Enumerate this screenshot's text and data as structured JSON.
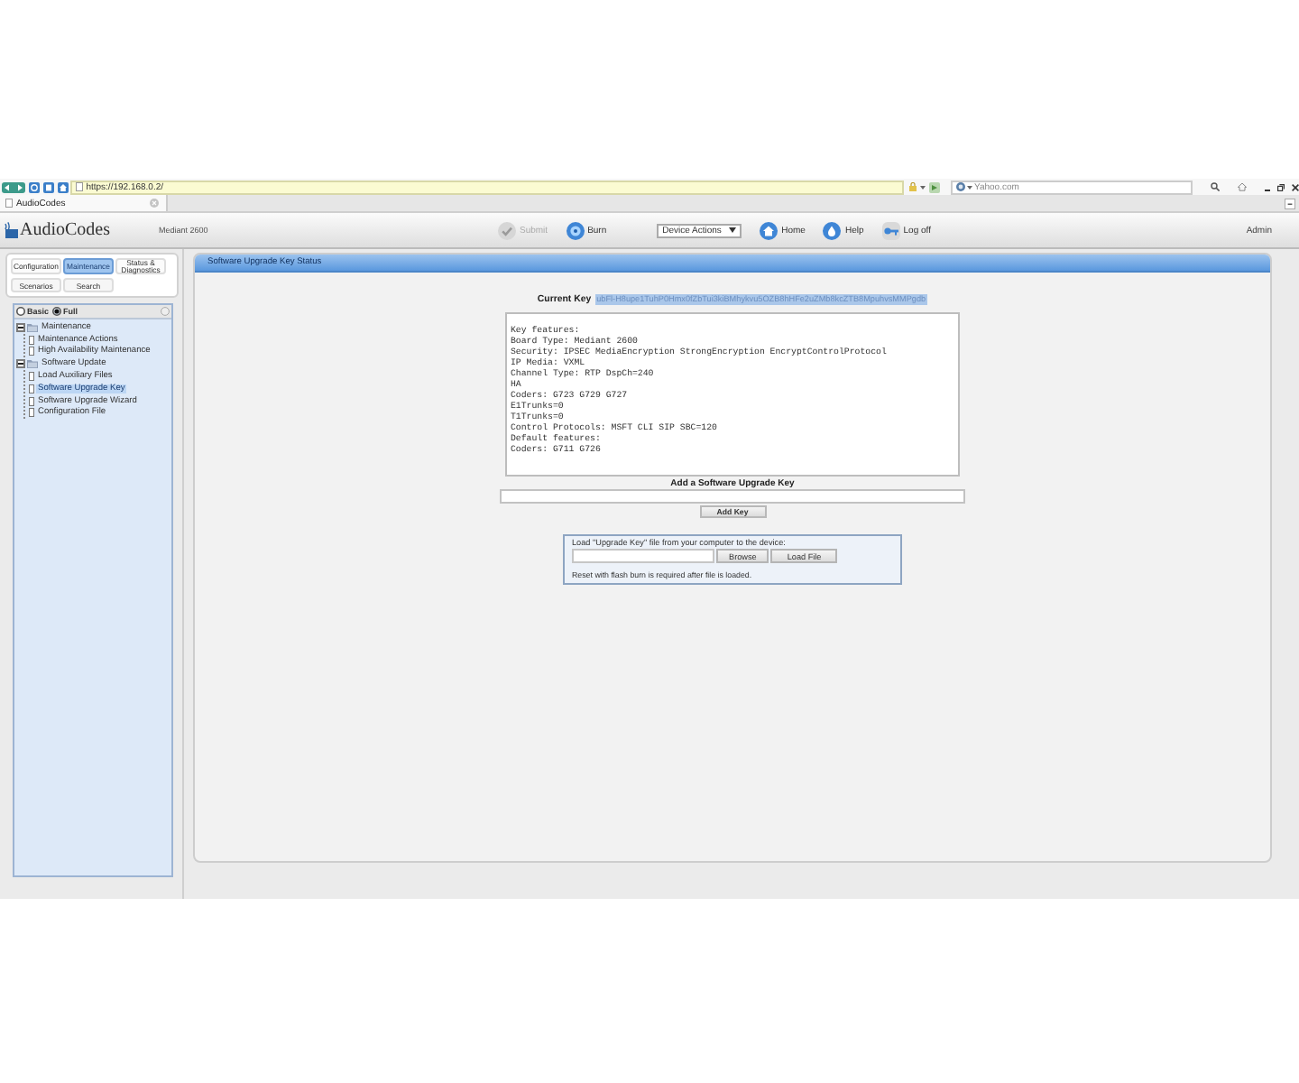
{
  "browser": {
    "address": "https://192.168.0.2/",
    "search": {
      "placeholder": "Yahoo.com"
    },
    "tab": "AudioCodes"
  },
  "header": {
    "logo": "AudioCodes",
    "device": "Mediant 2600",
    "toolbar": [
      {
        "label": "Submit",
        "kind": "button",
        "disabled": true
      },
      {
        "label": "Burn",
        "kind": "button",
        "disabled": false
      },
      {
        "label": "Device Actions",
        "kind": "dropdown",
        "disabled": false
      },
      {
        "label": "Home",
        "kind": "button",
        "disabled": false
      },
      {
        "label": "Help",
        "kind": "button",
        "disabled": false
      },
      {
        "label": "Log off",
        "kind": "button",
        "disabled": false
      }
    ],
    "user": "Admin"
  },
  "nav_tabs": [
    {
      "label": "Configuration",
      "selected": false
    },
    {
      "label": "Maintenance",
      "selected": true
    },
    {
      "label": "Status & Diagnostics",
      "selected": false
    }
  ],
  "nav_buttons": [
    "Scenarios",
    "Search"
  ],
  "view_mode": [
    {
      "label": "Basic",
      "selected": false
    },
    {
      "label": "Full",
      "selected": true
    }
  ],
  "tree": [
    {
      "label": "Maintenance",
      "expanded": true,
      "selected": false,
      "children": [
        {
          "label": "Maintenance Actions",
          "selected": false
        },
        {
          "label": "High Availability Maintenance",
          "selected": false
        }
      ]
    },
    {
      "label": "Software Update",
      "expanded": true,
      "selected": false,
      "children": [
        {
          "label": "Load Auxiliary Files",
          "selected": false
        },
        {
          "label": "Software Upgrade Key",
          "selected": true
        },
        {
          "label": "Software Upgrade Wizard",
          "selected": false
        },
        {
          "label": "Configuration File",
          "selected": false
        }
      ]
    }
  ],
  "panel": {
    "title": "Software Upgrade Key Status",
    "current_key": {
      "label": "Current Key",
      "value": "ubFl-H8upe1TuhP0Hmx0fZbTui3kiBMhykvu5OZB8hHFe2uZMb8kcZTB8MpuhvsMMPgdb"
    },
    "key_features": [
      "Key features:",
      "Board Type: Mediant 2600",
      "Security: IPSEC MediaEncryption StrongEncryption EncryptControlProtocol",
      "IP Media: VXML",
      "Channel Type: RTP DspCh=240",
      "HA",
      "Coders: G723 G729 G727",
      "E1Trunks=0",
      "T1Trunks=0",
      "Control Protocols: MSFT CLI SIP SBC=120",
      "Default features:",
      "Coders: G711 G726"
    ],
    "add_key": {
      "label": "Add a Software Upgrade Key",
      "button": "Add Key"
    },
    "load_file": {
      "label": "Load \"Upgrade Key\" file from your computer to the device:",
      "buttons": [
        "Browse",
        "Load File"
      ],
      "note": "Reset with flash burn is required after file is loaded."
    }
  }
}
